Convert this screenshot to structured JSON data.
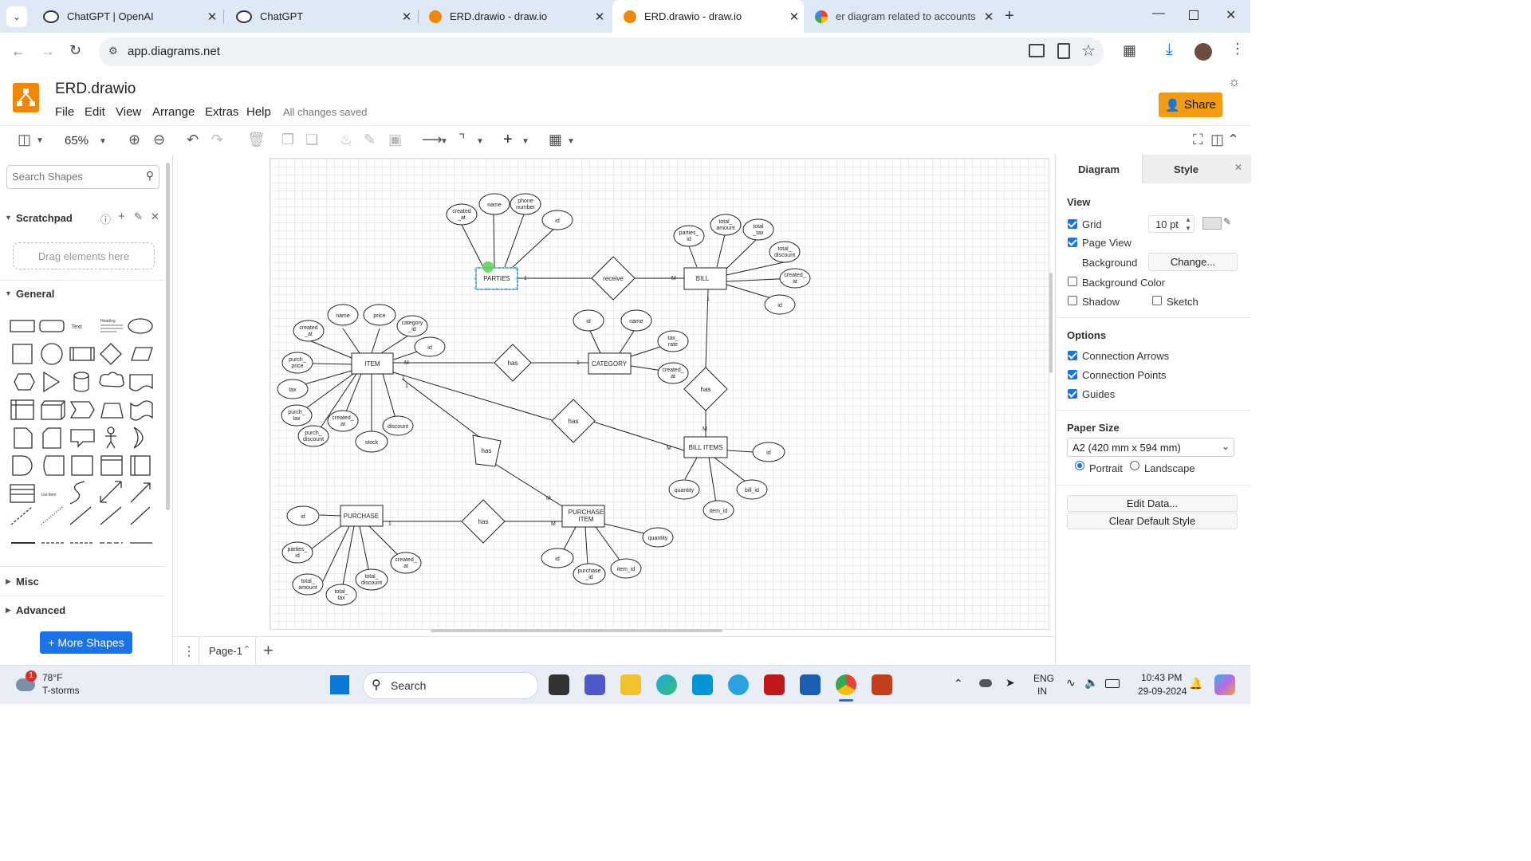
{
  "browser": {
    "tabs": [
      {
        "title": "ChatGPT | OpenAI",
        "active": false
      },
      {
        "title": "ChatGPT",
        "active": false
      },
      {
        "title": "ERD.drawio - draw.io",
        "active": false
      },
      {
        "title": "ERD.drawio - draw.io",
        "active": true
      },
      {
        "title": "er diagram related to accounts",
        "active": false
      }
    ],
    "url": "app.diagrams.net"
  },
  "app": {
    "file_name": "ERD.drawio",
    "menus": [
      "File",
      "Edit",
      "View",
      "Arrange",
      "Extras",
      "Help"
    ],
    "save_status": "All changes saved",
    "share_label": "Share",
    "zoom": "65%"
  },
  "left_panel": {
    "search_placeholder": "Search Shapes",
    "scratchpad": "Scratchpad",
    "drag_hint": "Drag elements here",
    "general": "General",
    "misc": "Misc",
    "advanced": "Advanced",
    "more_shapes": "+ More Shapes",
    "shape_text": "Text",
    "shape_heading": "Heading",
    "shape_list_item": "List Item"
  },
  "page_tab": "Page-1",
  "right_panel": {
    "tabs": [
      "Diagram",
      "Style"
    ],
    "view_heading": "View",
    "grid": {
      "label": "Grid",
      "checked": true,
      "size": "10 pt"
    },
    "page_view": {
      "label": "Page View",
      "checked": true
    },
    "background_label": "Background",
    "change_button": "Change...",
    "background_color": {
      "label": "Background Color",
      "checked": false
    },
    "shadow": {
      "label": "Shadow",
      "checked": false
    },
    "sketch": {
      "label": "Sketch",
      "checked": false
    },
    "options_heading": "Options",
    "connection_arrows": {
      "label": "Connection Arrows",
      "checked": true
    },
    "connection_points": {
      "label": "Connection Points",
      "checked": true
    },
    "guides": {
      "label": "Guides",
      "checked": true
    },
    "paper_size_heading": "Paper Size",
    "paper_size": "A2 (420 mm x 594 mm)",
    "portrait": "Portrait",
    "landscape": "Landscape",
    "orientation": "Portrait",
    "edit_data": "Edit Data...",
    "clear_default_style": "Clear Default Style"
  },
  "diagram": {
    "entities": {
      "parties": "PARTIES",
      "bill": "BILL",
      "item": "ITEM",
      "category": "CATEGORY",
      "bill_items": "BILL ITEMS",
      "purchase": "PURCHASE",
      "purchase_item_1": "PURCHASE",
      "purchase_item_2": "ITEM"
    },
    "relationships": {
      "receive": "receive",
      "has": "has"
    },
    "cardinality": {
      "one": "1",
      "many": "M"
    },
    "attributes": {
      "parties_created_at_1": "created",
      "parties_created_at_2": "_at",
      "parties_name": "name",
      "parties_phone_1": "phone",
      "parties_phone_2": "number",
      "parties_id": "id",
      "bill_parties_id_1": "parties_",
      "bill_parties_id_2": "id",
      "bill_total_amount_1": "total_",
      "bill_total_amount_2": "amount",
      "bill_total_tax_1": "total",
      "bill_total_tax_2": "_tax",
      "bill_total_discount_1": "total_",
      "bill_total_discount_2": "discount",
      "bill_created_at_1": "created_",
      "bill_created_at_2": "at",
      "bill_id": "id",
      "item_created_at_1": "created",
      "item_created_at_2": "_at",
      "item_name": "name",
      "item_price": "price",
      "item_category_id_1": "category",
      "item_category_id_2": "_id",
      "item_id": "id",
      "item_purch_price_1": "purch_",
      "item_purch_price_2": "price",
      "item_tax": "tax",
      "item_purch_tax_1": "purch_",
      "item_purch_tax_2": "tax",
      "item_created_at2_1": "created_",
      "item_created_at2_2": "at",
      "item_purch_discount_1": "purch_",
      "item_purch_discount_2": "discount",
      "item_stock": "stock",
      "item_discount": "discount",
      "cat_id": "id",
      "cat_name": "name",
      "cat_tax_rate_1": "tax_",
      "cat_tax_rate_2": "rate",
      "cat_created_at_1": "created_",
      "cat_created_at_2": "at",
      "bi_id": "id",
      "bi_quantity": "quantity",
      "bi_item_id": "item_id",
      "bi_bill_id": "bill_id",
      "pur_id": "id",
      "pur_parties_id_1": "parties_",
      "pur_parties_id_2": "id",
      "pur_total_amount_1": "total_",
      "pur_total_amount_2": "amount",
      "pur_total_tax_1": "total_",
      "pur_total_tax_2": "tax",
      "pur_total_discount_1": "total_",
      "pur_total_discount_2": "discount",
      "pur_created_at_1": "created_",
      "pur_created_at_2": "at",
      "pi_id": "id",
      "pi_purchase_id_1": "purchase",
      "pi_purchase_id_2": "_id",
      "pi_item_id": "item_id",
      "pi_quantity": "quantity"
    }
  },
  "taskbar": {
    "weather_temp": "78°F",
    "weather_desc": "T-storms",
    "weather_badge": "1",
    "search": "Search",
    "lang_1": "ENG",
    "lang_2": "IN",
    "time": "10:43 PM",
    "date": "29-09-2024"
  },
  "colors": {
    "drawio_orange": "#f08705",
    "share_orange": "#f39c12",
    "chrome_blue": "#1a73e8",
    "selection": "#29b6f2"
  }
}
